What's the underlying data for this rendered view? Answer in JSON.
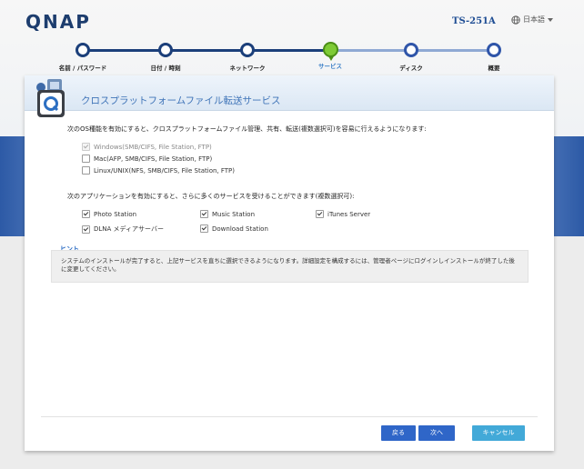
{
  "app": {
    "logo": "QNAP",
    "model": "TS-251A",
    "language": "日本語"
  },
  "wizard": {
    "steps": [
      {
        "label": "名前 / パスワード",
        "state": "done"
      },
      {
        "label": "日付 / 時刻",
        "state": "done"
      },
      {
        "label": "ネットワーク",
        "state": "done"
      },
      {
        "label": "サービス",
        "state": "current"
      },
      {
        "label": "ディスク",
        "state": "todo"
      },
      {
        "label": "概要",
        "state": "todo"
      }
    ]
  },
  "panel": {
    "title": "クロスプラットフォームファイル転送サービス",
    "os_description": "次のOS種能を有効にすると、クロスプラットフォームファイル管理、共有、転送(複数選択可)を容易に行えるようになります:",
    "os_options": [
      {
        "label": "Windows(SMB/CIFS, File Station, FTP)",
        "checked": true,
        "disabled": true
      },
      {
        "label": "Mac(AFP, SMB/CIFS, File Station, FTP)",
        "checked": false,
        "disabled": false
      },
      {
        "label": "Linux/UNIX(NFS, SMB/CIFS, File Station, FTP)",
        "checked": false,
        "disabled": false
      }
    ],
    "app_description": "次のアプリケーションを有効にすると、さらに多くのサービスを受けることができます(複数選択可):",
    "app_options": [
      {
        "label": "Photo Station",
        "checked": true
      },
      {
        "label": "Music Station",
        "checked": true
      },
      {
        "label": "iTunes Server",
        "checked": true
      },
      {
        "label": "DLNA メディアサーバー",
        "checked": true
      },
      {
        "label": "Download Station",
        "checked": true
      }
    ],
    "hint": {
      "label": "ヒント",
      "text": "システムのインストールが完了すると、上記サービスを直ちに選択できるようになります。詳細設定を構成するには、管理者ページにログインしインストールが終了した後に変更してください。"
    }
  },
  "buttons": {
    "back": "戻る",
    "next": "次へ",
    "cancel": "キャンセル"
  },
  "colors": {
    "primary": "#2f66c8",
    "cancel": "#42a9d8",
    "step_done": "#1b3f7a",
    "step_current": "#7ecb35",
    "title": "#3f74b8"
  }
}
